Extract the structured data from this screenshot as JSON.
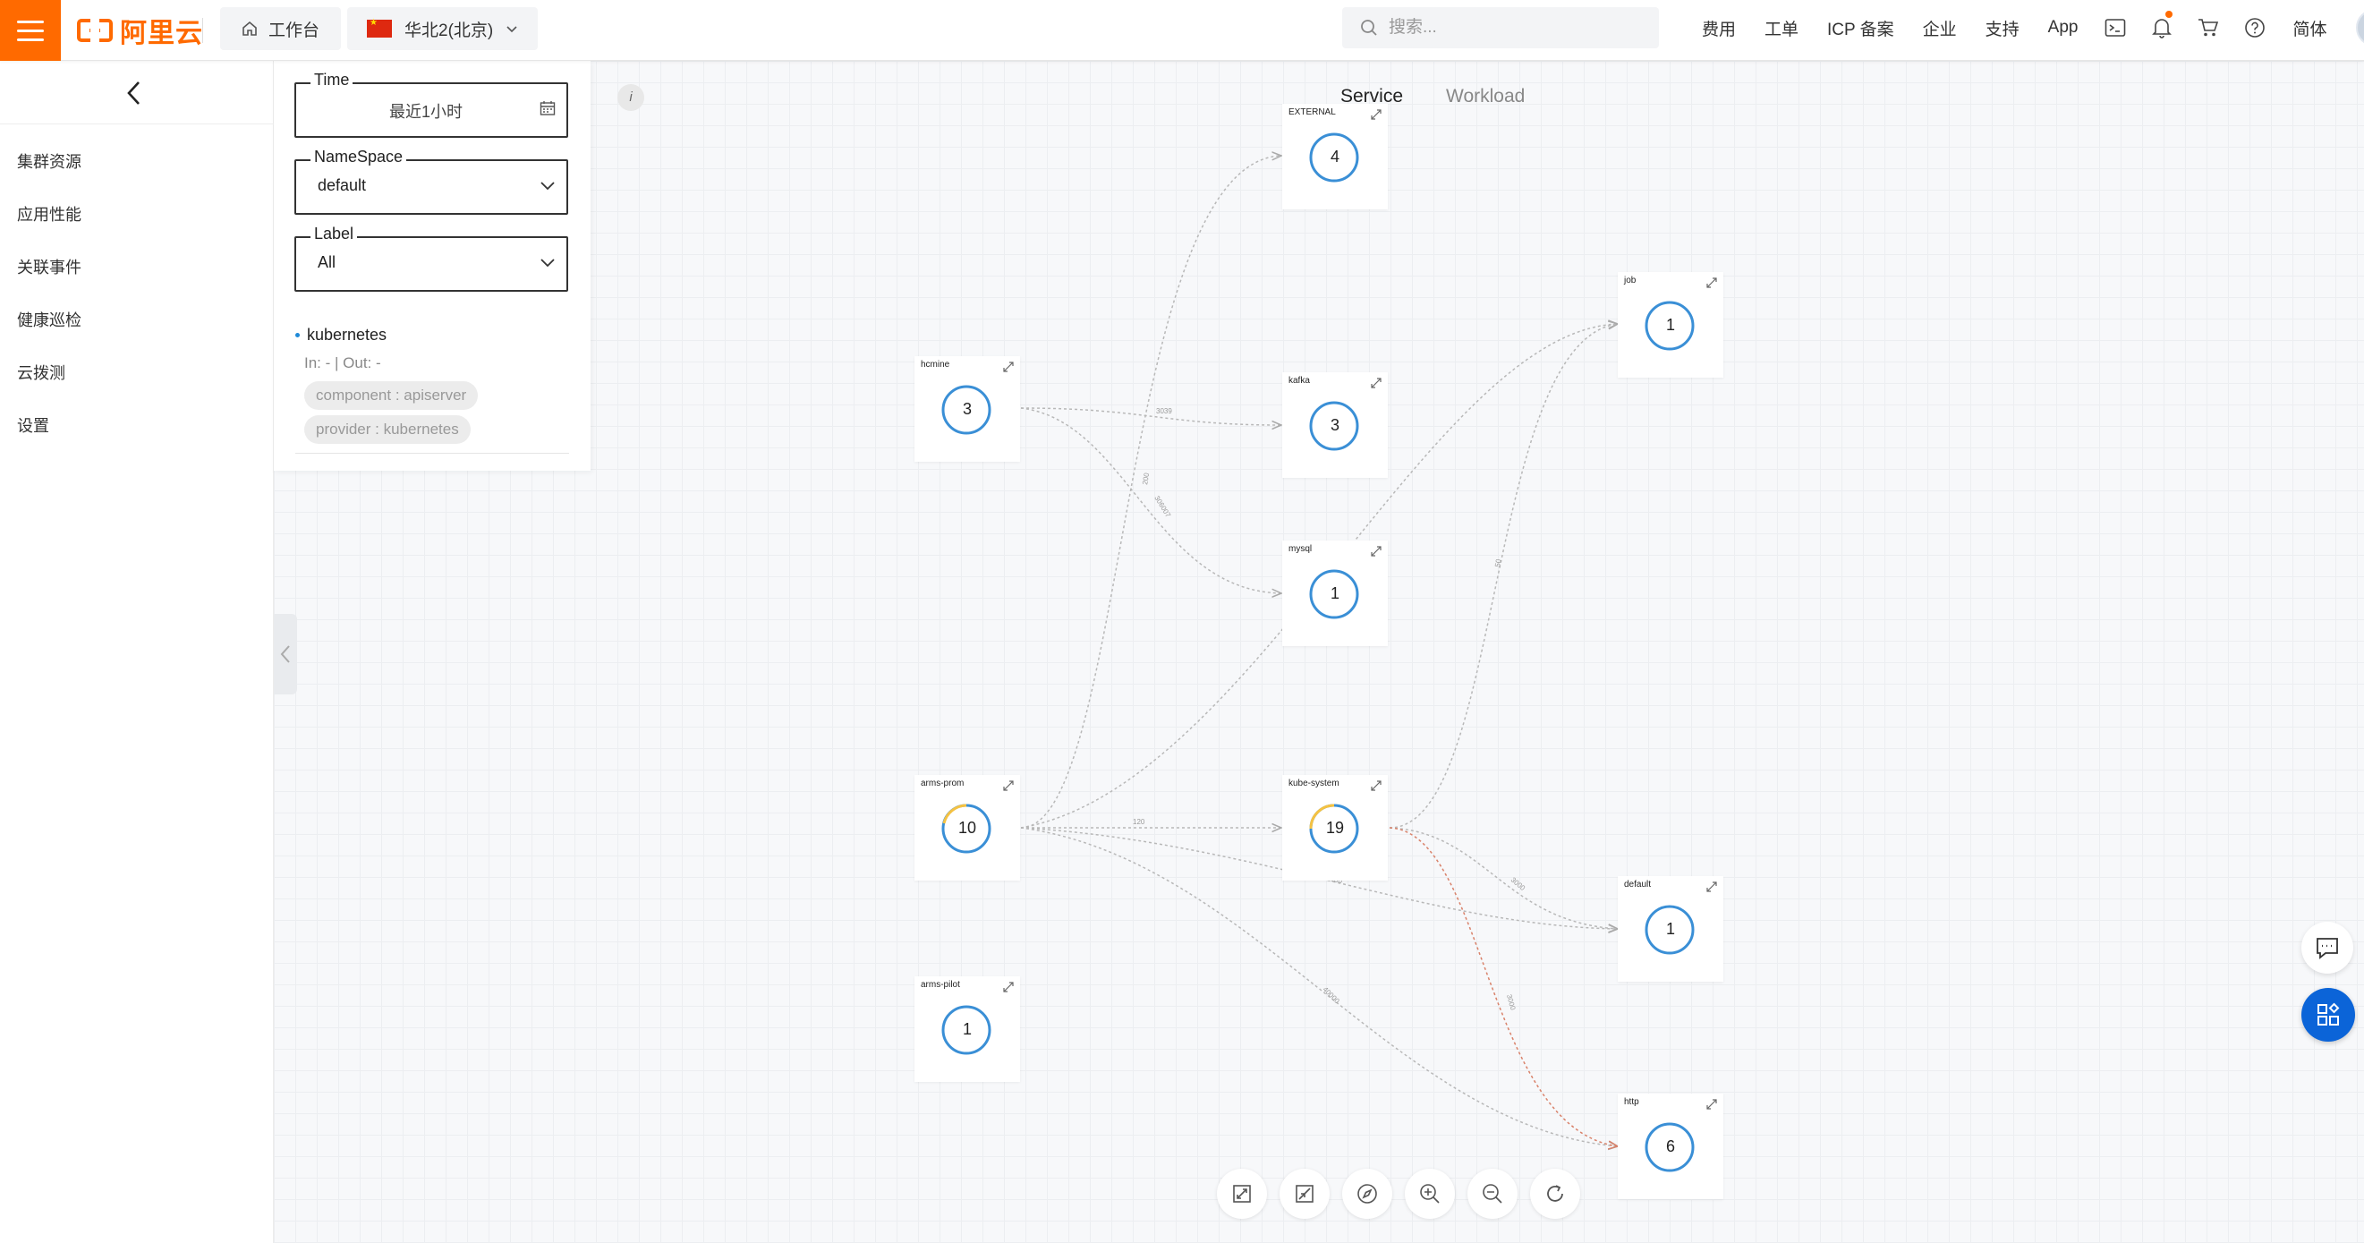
{
  "header": {
    "logo_text": "阿里云",
    "workbench_label": "工作台",
    "region_label": "华北2(北京)",
    "search_placeholder": "搜索...",
    "nav": [
      "费用",
      "工单",
      "ICP 备案",
      "企业",
      "支持",
      "App"
    ],
    "language_label": "简体",
    "accent_color": "#ff6a00"
  },
  "sidebar": {
    "items": [
      {
        "label": "集群资源"
      },
      {
        "label": "应用性能"
      },
      {
        "label": "关联事件"
      },
      {
        "label": "健康巡检"
      },
      {
        "label": "云拨测"
      },
      {
        "label": "设置"
      }
    ]
  },
  "filters": {
    "time": {
      "label": "Time",
      "value": "最近1小时"
    },
    "namespace": {
      "label": "NameSpace",
      "value": "default"
    },
    "label": {
      "label": "Label",
      "value": "All"
    }
  },
  "selected_node": {
    "name": "kubernetes",
    "io_text": "In: - | Out: -",
    "tags": [
      "component : apiserver",
      "provider : kubernetes"
    ]
  },
  "info_button": "i",
  "tabs": [
    {
      "label": "Service",
      "active": true
    },
    {
      "label": "Workload",
      "active": false
    }
  ],
  "graph": {
    "nodes": [
      {
        "id": "EXTERNAL",
        "label": "EXTERNAL",
        "count": "4",
        "ring": "blue"
      },
      {
        "id": "job",
        "label": "job",
        "count": "1",
        "ring": "blue"
      },
      {
        "id": "hcmine",
        "label": "hcmine",
        "count": "3",
        "ring": "blue"
      },
      {
        "id": "kafka",
        "label": "kafka",
        "count": "3",
        "ring": "blue"
      },
      {
        "id": "mysql",
        "label": "mysql",
        "count": "1",
        "ring": "blue"
      },
      {
        "id": "arms-prom",
        "label": "arms-prom",
        "count": "10",
        "ring": "mixed"
      },
      {
        "id": "kube-system",
        "label": "kube-system",
        "count": "19",
        "ring": "mixed"
      },
      {
        "id": "default",
        "label": "default",
        "count": "1",
        "ring": "blue"
      },
      {
        "id": "arms-pilot",
        "label": "arms-pilot",
        "count": "1",
        "ring": "blue"
      },
      {
        "id": "http",
        "label": "http",
        "count": "6",
        "ring": "blue"
      }
    ],
    "edges": [
      {
        "from": "hcmine",
        "to": "kafka",
        "label": "3039"
      },
      {
        "from": "hcmine",
        "to": "mysql",
        "label": "306007"
      },
      {
        "from": "arms-prom",
        "to": "EXTERNAL",
        "label": "200"
      },
      {
        "from": "arms-prom",
        "to": "job",
        "label": "20"
      },
      {
        "from": "arms-prom",
        "to": "kube-system",
        "label": "120"
      },
      {
        "from": "arms-prom",
        "to": "default",
        "label": "9080"
      },
      {
        "from": "arms-prom",
        "to": "http",
        "label": "40000"
      },
      {
        "from": "kube-system",
        "to": "job",
        "label": "50"
      },
      {
        "from": "kube-system",
        "to": "default",
        "label": "3000"
      },
      {
        "from": "kube-system",
        "to": "http",
        "label": "3000"
      }
    ],
    "colors": {
      "ring_blue": "#3a8fd6",
      "ring_yellow": "#f5c242",
      "edge": "#b8b8b8",
      "edge_alert": "#d9826a"
    }
  },
  "toolbar": [
    "fit-view-icon",
    "actual-size-icon",
    "compass-icon",
    "zoom-in-icon",
    "zoom-out-icon",
    "refresh-icon"
  ]
}
